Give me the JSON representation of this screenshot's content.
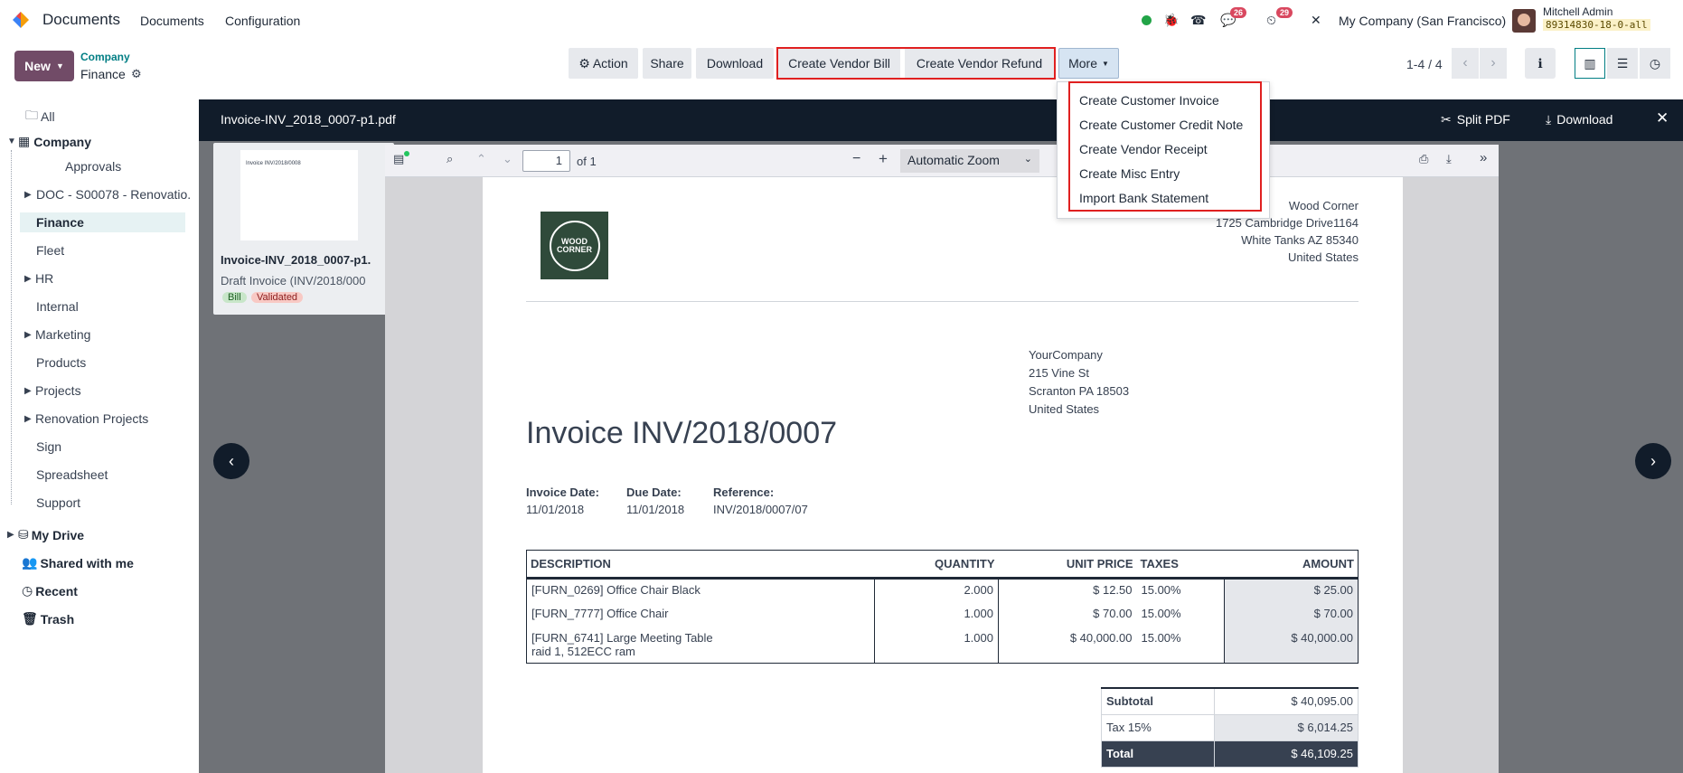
{
  "topnav": {
    "app_name": "Documents",
    "menu": [
      "Documents",
      "Configuration"
    ],
    "discuss_count": "26",
    "activity_count": "29",
    "company": "My Company (San Francisco)",
    "user_name": "Mitchell Admin",
    "db_name": "89314830-18-0-all"
  },
  "control": {
    "new_label": "New",
    "breadcrumb_parent": "Company",
    "breadcrumb_current": "Finance",
    "actions": {
      "action": "Action",
      "share": "Share",
      "download": "Download",
      "vendor_bill": "Create Vendor Bill",
      "vendor_refund": "Create Vendor Refund",
      "more": "More"
    },
    "pager": "1-4 / 4"
  },
  "more_menu": [
    "Create Customer Invoice",
    "Create Customer Credit Note",
    "Create Vendor Receipt",
    "Create Misc Entry",
    "Import Bank Statement"
  ],
  "sidebar": {
    "all": "All",
    "company": "Company",
    "folders": [
      "Approvals",
      "DOC - S00078 - Renovatio.",
      "Finance",
      "Fleet",
      "HR",
      "Internal",
      "Marketing",
      "Products",
      "Projects",
      "Renovation Projects",
      "Sign",
      "Spreadsheet",
      "Support"
    ],
    "my_drive": "My Drive",
    "shared": "Shared with me",
    "recent": "Recent",
    "trash": "Trash"
  },
  "card": {
    "title": "Invoice-INV_2018_0007-p1.",
    "subtitle": "Draft Invoice (INV/2018/000",
    "tag_bill": "Bill",
    "tag_validated": "Validated",
    "thumb_title": "Invoice INV/2018/0008"
  },
  "viewer": {
    "filename": "Invoice-INV_2018_0007-p1.pdf",
    "split": "Split PDF",
    "download": "Download",
    "page_value": "1",
    "page_of": "of 1",
    "zoom": "Automatic Zoom"
  },
  "invoice": {
    "logo_text": "WOOD CORNER",
    "vendor": [
      "Wood Corner",
      "1725 Cambridge Drive1164",
      "White Tanks AZ 85340",
      "United States"
    ],
    "customer": [
      "YourCompany",
      "215 Vine St",
      "Scranton PA 18503",
      "United States"
    ],
    "title": "Invoice INV/2018/0007",
    "invoice_date_label": "Invoice Date:",
    "invoice_date": "11/01/2018",
    "due_date_label": "Due Date:",
    "due_date": "11/01/2018",
    "reference_label": "Reference:",
    "reference": "INV/2018/0007/07",
    "columns": [
      "DESCRIPTION",
      "QUANTITY",
      "UNIT PRICE",
      "TAXES",
      "AMOUNT"
    ],
    "lines": [
      {
        "desc": "[FURN_0269] Office Chair Black",
        "desc2": "",
        "qty": "2.000",
        "price": "$ 12.50",
        "tax": "15.00%",
        "amount": "$ 25.00"
      },
      {
        "desc": "[FURN_7777] Office Chair",
        "desc2": "",
        "qty": "1.000",
        "price": "$ 70.00",
        "tax": "15.00%",
        "amount": "$ 70.00"
      },
      {
        "desc": "[FURN_6741] Large Meeting Table",
        "desc2": "raid 1, 512ECC ram",
        "qty": "1.000",
        "price": "$ 40,000.00",
        "tax": "15.00%",
        "amount": "$ 40,000.00"
      }
    ],
    "subtotal_label": "Subtotal",
    "subtotal": "$ 40,095.00",
    "tax_label": "Tax 15%",
    "tax": "$ 6,014.25",
    "total_label": "Total",
    "total": "$ 46,109.25"
  }
}
